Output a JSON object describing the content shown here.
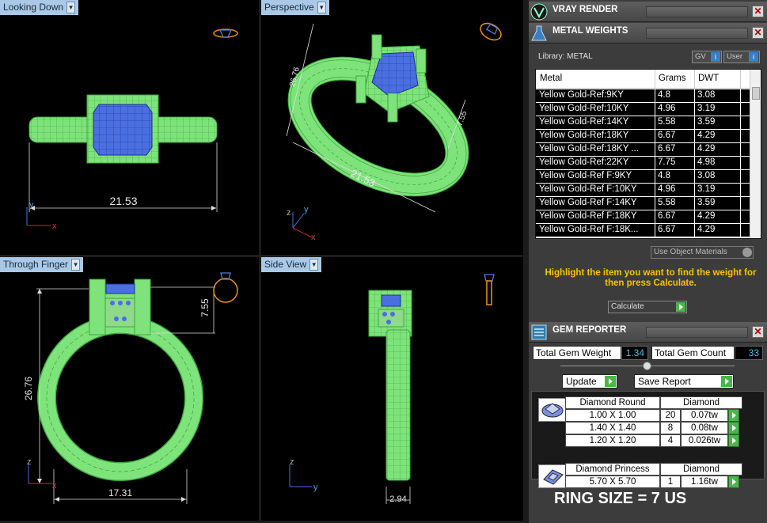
{
  "viewports": {
    "top_left": {
      "label": "Looking Down",
      "dim": "21.53"
    },
    "top_right": {
      "label": "Perspective",
      "dim_main": "21.53",
      "dim_side": "7.55",
      "dim_vert": "26.76"
    },
    "bottom_left": {
      "label": "Through Finger",
      "dim_height": "26.76",
      "dim_top": "7.55",
      "dim_width": "17.31"
    },
    "bottom_right": {
      "label": "Side View",
      "dim_width": "2.94"
    }
  },
  "axes": {
    "x": "x",
    "y": "y",
    "z": "z"
  },
  "panel": {
    "vray": {
      "title": "VRAY RENDER"
    },
    "metal": {
      "title": "METAL WEIGHTS",
      "library_label": "Library: METAL",
      "toggle_gv": "GV",
      "toggle_user": "User",
      "toggle_icon": "i",
      "columns": {
        "metal": "Metal",
        "grams": "Grams",
        "dwt": "DWT"
      },
      "rows": [
        {
          "metal": "Yellow Gold-Ref:9KY",
          "grams": "4.8",
          "dwt": "3.08"
        },
        {
          "metal": "Yellow Gold-Ref:10KY",
          "grams": "4.96",
          "dwt": "3.19"
        },
        {
          "metal": "Yellow Gold-Ref:14KY",
          "grams": "5.58",
          "dwt": "3.59"
        },
        {
          "metal": "Yellow Gold-Ref:18KY",
          "grams": "6.67",
          "dwt": "4.29"
        },
        {
          "metal": "Yellow Gold-Ref:18KY ...",
          "grams": "6.67",
          "dwt": "4.29"
        },
        {
          "metal": "Yellow Gold-Ref:22KY",
          "grams": "7.75",
          "dwt": "4.98"
        },
        {
          "metal": "Yellow Gold-Ref F:9KY",
          "grams": "4.8",
          "dwt": "3.08"
        },
        {
          "metal": "Yellow Gold-Ref F:10KY",
          "grams": "4.96",
          "dwt": "3.19"
        },
        {
          "metal": "Yellow Gold-Ref F:14KY",
          "grams": "5.58",
          "dwt": "3.59"
        },
        {
          "metal": "Yellow Gold-Ref F:18KY",
          "grams": "6.67",
          "dwt": "4.29"
        },
        {
          "metal": "Yellow Gold-Ref F:18K...",
          "grams": "6.67",
          "dwt": "4.29"
        }
      ],
      "use_object_materials": "Use Object Materials",
      "hint": "Highlight the item you want to find the weight for then press Calculate.",
      "calculate": "Calculate"
    },
    "gem": {
      "title": "GEM REPORTER",
      "total_weight_label": "Total Gem Weight",
      "total_weight": "1.34",
      "total_count_label": "Total Gem Count",
      "total_count": "33",
      "update": "Update",
      "save_report": "Save Report",
      "groups": [
        {
          "shape": "Diamond Round",
          "material": "Diamond",
          "rows": [
            {
              "size": "1.00 X 1.00",
              "count": "20",
              "tw": "0.07tw"
            },
            {
              "size": "1.40 X 1.40",
              "count": "8",
              "tw": "0.08tw"
            },
            {
              "size": "1.20 X 1.20",
              "count": "4",
              "tw": "0.026tw"
            }
          ]
        },
        {
          "shape": "Diamond Princess",
          "material": "Diamond",
          "rows": [
            {
              "size": "5.70 X 5.70",
              "count": "1",
              "tw": "1.16tw"
            }
          ]
        }
      ]
    },
    "ring_size": "RING SIZE = 7 US"
  },
  "colors": {
    "ring_green": "#7de37a",
    "stone_blue": "#4a6fe0",
    "dim_white": "#e8e8e8",
    "label_blue": "#a9c9e6",
    "hint_yellow": "#f5c400",
    "value_cyan": "#4ec0f0",
    "go_green": "#49b649"
  },
  "icons": {
    "vray": "vray-logo-icon",
    "metal": "metal-flask-icon",
    "gem": "gem-reporter-icon",
    "dropdown": "chevron-down-icon",
    "close": "close-icon",
    "go": "play-arrow-icon"
  }
}
